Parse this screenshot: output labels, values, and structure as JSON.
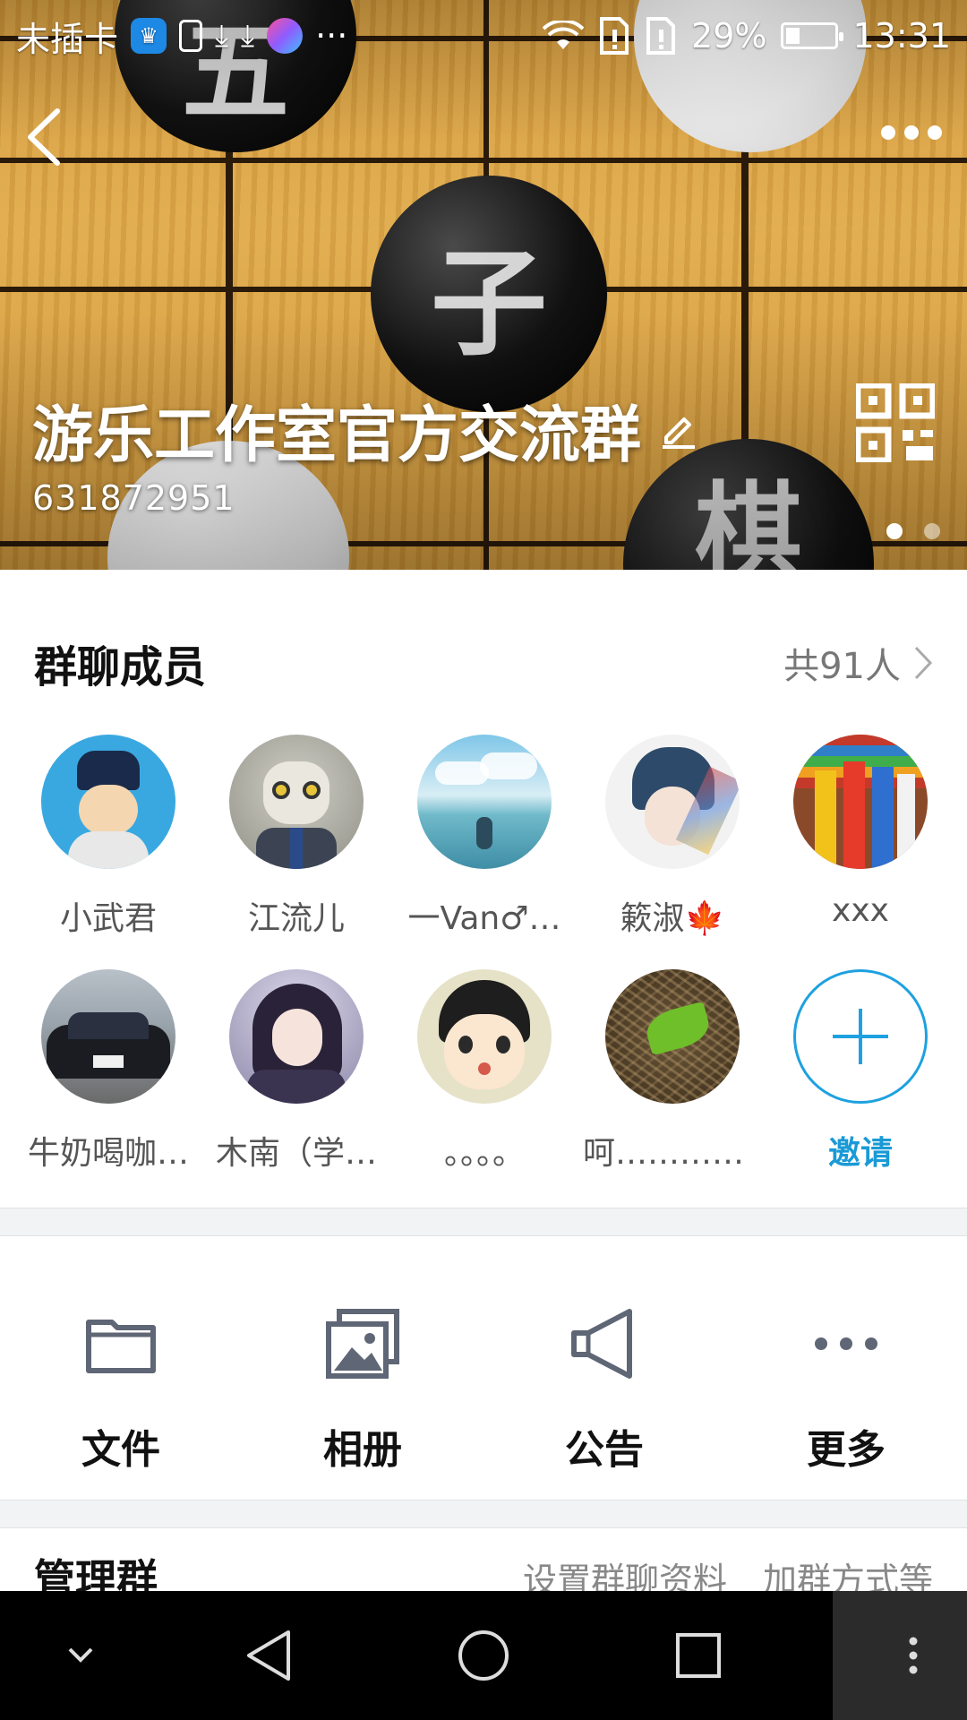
{
  "status_bar": {
    "carrier": "未插卡",
    "battery_percent": "29%",
    "battery_level": 0.29,
    "time": "13:31",
    "overflow_label": "···"
  },
  "header": {
    "group_name": "游乐工作室官方交流群",
    "group_id": "631872951",
    "banner_glyphs": [
      "五",
      "子",
      "棋"
    ],
    "pager_count": 2,
    "pager_active": 0
  },
  "members": {
    "title": "群聊成员",
    "count_label": "共91人",
    "list": [
      {
        "name": "小武君",
        "avatar": "cartoon-scholar-avatar"
      },
      {
        "name": "江流儿",
        "avatar": "owl-in-suit-avatar"
      },
      {
        "name": "一Van♂…",
        "avatar": "clouds-landscape-avatar"
      },
      {
        "name": "簌淑🍁",
        "avatar": "anime-boy-avatar"
      },
      {
        "name": "xxx",
        "avatar": "colored-pencils-avatar"
      },
      {
        "name": "牛奶喝咖…",
        "avatar": "black-car-avatar"
      },
      {
        "name": "木南（学…",
        "avatar": "anime-girl-avatar"
      },
      {
        "name": "。。。。",
        "avatar": "cartoon-kid-avatar"
      },
      {
        "name": "呵…………呵",
        "avatar": "leaf-in-nest-avatar"
      }
    ],
    "invite_label": "邀请"
  },
  "tools": [
    {
      "label": "文件",
      "icon": "folder-icon"
    },
    {
      "label": "相册",
      "icon": "photo-album-icon"
    },
    {
      "label": "公告",
      "icon": "megaphone-icon"
    },
    {
      "label": "更多",
      "icon": "more-dots-icon"
    }
  ],
  "manage": {
    "title": "管理群",
    "desc_1": "设置群聊资料",
    "desc_2": "加群方式等"
  },
  "colors": {
    "accent": "#1a9ad6",
    "icon_gray": "#5f6675",
    "nav_bg": "#000000"
  }
}
